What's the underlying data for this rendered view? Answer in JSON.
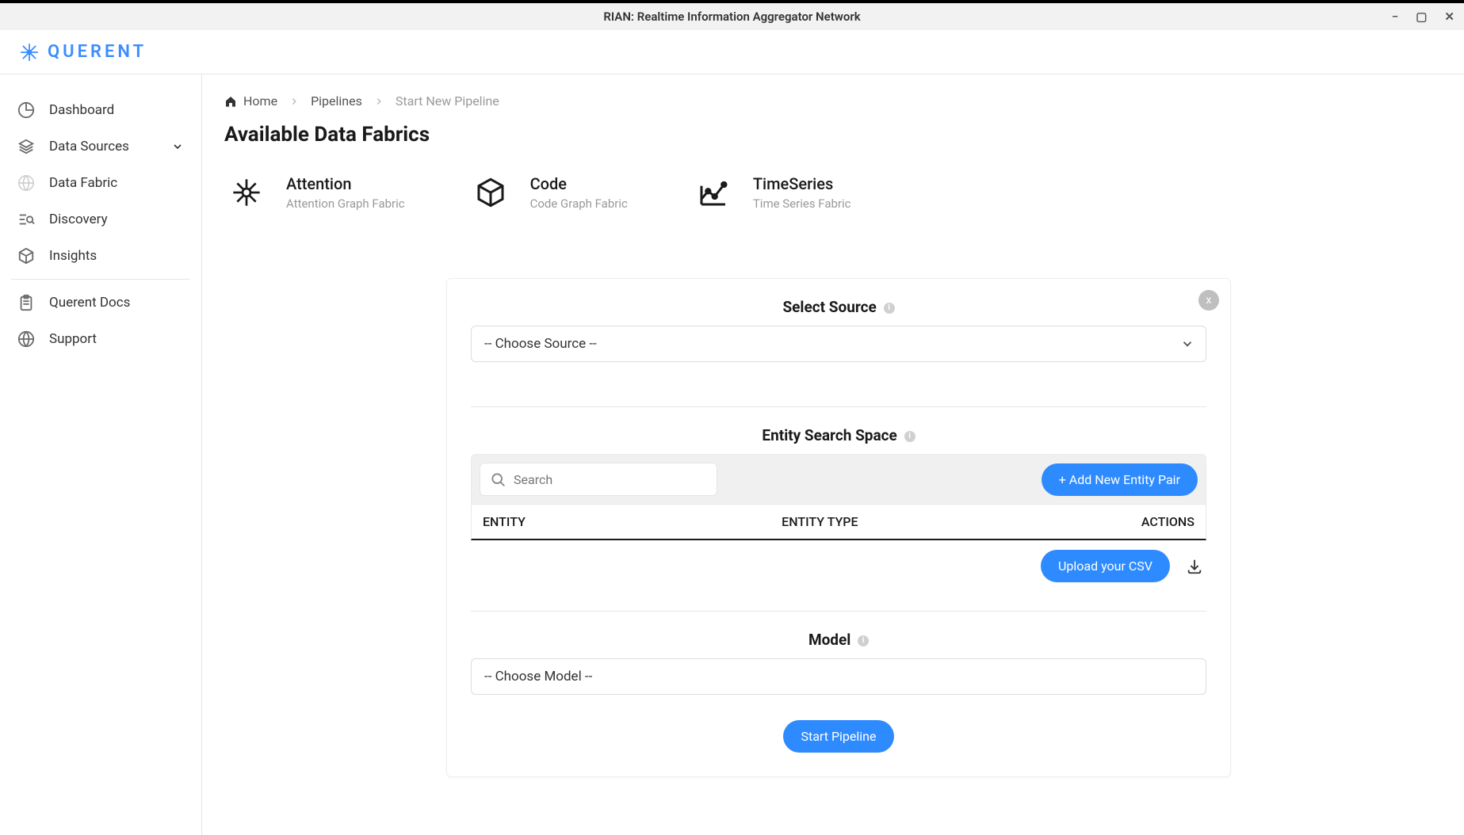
{
  "window": {
    "title": "RIAN: Realtime Information Aggregator Network",
    "min_icon": "−",
    "max_icon": "▢",
    "close_icon": "✕"
  },
  "brand": {
    "text": "QUERENT"
  },
  "sidebar": {
    "items": [
      {
        "label": "Dashboard"
      },
      {
        "label": "Data Sources"
      },
      {
        "label": "Data Fabric"
      },
      {
        "label": "Discovery"
      },
      {
        "label": "Insights"
      },
      {
        "label": "Querent Docs"
      },
      {
        "label": "Support"
      }
    ]
  },
  "breadcrumb": {
    "home": "Home",
    "pipelines": "Pipelines",
    "current": "Start New Pipeline"
  },
  "page": {
    "title": "Available Data Fabrics"
  },
  "fabrics": [
    {
      "title": "Attention",
      "sub": "Attention Graph Fabric"
    },
    {
      "title": "Code",
      "sub": "Code Graph Fabric"
    },
    {
      "title": "TimeSeries",
      "sub": "Time Series Fabric"
    }
  ],
  "panel": {
    "select_source_label": "Select Source",
    "source_placeholder": "-- Choose Source --",
    "entity_label": "Entity Search Space",
    "search_placeholder": "Search",
    "add_entity_button": "+ Add New Entity Pair",
    "th_entity": "ENTITY",
    "th_entity_type": "ENTITY TYPE",
    "th_actions": "ACTIONS",
    "upload_button": "Upload your CSV",
    "model_label": "Model",
    "model_placeholder": "-- Choose Model --",
    "start_button": "Start Pipeline",
    "close_x": "x"
  }
}
